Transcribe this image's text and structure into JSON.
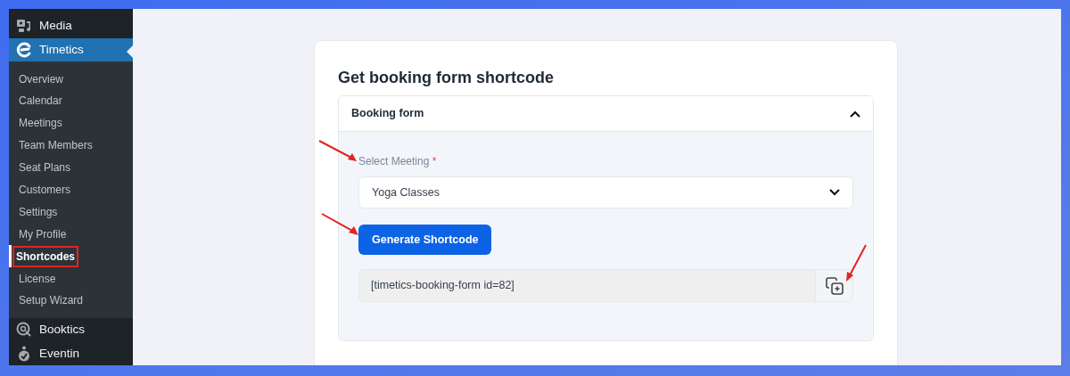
{
  "sidebar": {
    "menu": [
      {
        "label": "Media",
        "kind": "media",
        "selected": false
      },
      {
        "label": "Timetics",
        "kind": "timetics",
        "selected": true,
        "submenu": [
          {
            "label": "Overview",
            "selected": false,
            "highlighted": false
          },
          {
            "label": "Calendar",
            "selected": false,
            "highlighted": false
          },
          {
            "label": "Meetings",
            "selected": false,
            "highlighted": false
          },
          {
            "label": "Team Members",
            "selected": false,
            "highlighted": false
          },
          {
            "label": "Seat Plans",
            "selected": false,
            "highlighted": false
          },
          {
            "label": "Customers",
            "selected": false,
            "highlighted": false
          },
          {
            "label": "Settings",
            "selected": false,
            "highlighted": false
          },
          {
            "label": "My Profile",
            "selected": false,
            "highlighted": false
          },
          {
            "label": "Shortcodes",
            "selected": true,
            "highlighted": true
          },
          {
            "label": "License",
            "selected": false,
            "highlighted": false
          },
          {
            "label": "Setup Wizard",
            "selected": false,
            "highlighted": false
          }
        ]
      },
      {
        "label": "Booktics",
        "kind": "booktics",
        "selected": false
      },
      {
        "label": "Eventin",
        "kind": "eventin",
        "selected": false
      }
    ]
  },
  "card": {
    "title": "Get booking form shortcode",
    "accordion": {
      "title": "Booking form",
      "expanded": true,
      "select": {
        "label": "Select Meeting",
        "required_mark": "*",
        "value": "Yoga Classes"
      },
      "button": "Generate Shortcode",
      "shortcode": "[timetics-booking-form id=82]"
    }
  }
}
